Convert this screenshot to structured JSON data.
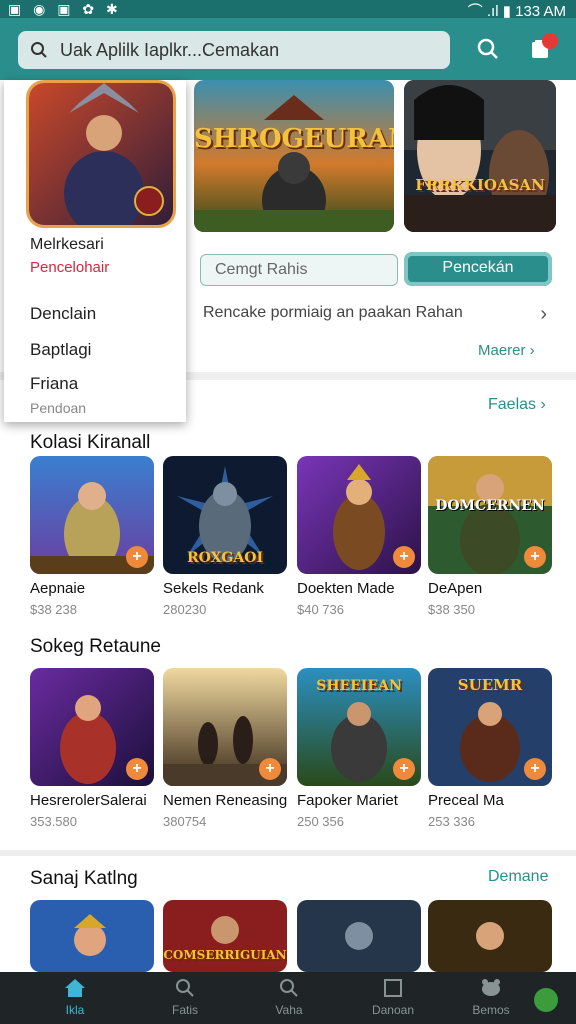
{
  "status_bar": {
    "left_icons": "▣ ◉ ▣ ✿ ✱",
    "right": "⌒ .ıl ▮ 133 AM"
  },
  "header": {
    "search_placeholder": "Uak Aplilk Iaplkr...Cemakan",
    "icons": [
      "search-icon",
      "cart-icon"
    ]
  },
  "featured": {
    "banner1_title": "SHROGEURAN",
    "banner2_title": "FRRKKIOASAN",
    "search_placeholder": "Cemgt Rahis",
    "button_label": "Pencekán",
    "link_text": "Rencake pormiaig an paakan Rahan",
    "more_label": "Maerer"
  },
  "dropdown": {
    "title": "Melrkesari",
    "subtitle": "Pencelohair",
    "items": [
      "Denclain",
      "Baptlagi",
      "Friana"
    ],
    "footer": "Pendoan"
  },
  "sections": [
    {
      "title": "Kolasi Kiranall",
      "link": "Faelas",
      "items": [
        {
          "name": "Aepnaie",
          "price": "$38 238"
        },
        {
          "name": "Sekels Redank",
          "price": "280230"
        },
        {
          "name": "Doekten Made",
          "price": "$40 736"
        },
        {
          "name": "DeApen",
          "price": "$38 350"
        }
      ],
      "overlay_texts": [
        "",
        "ROXGAOI",
        "",
        "DOMCERNEN"
      ]
    },
    {
      "title": "Sokeg Retaune",
      "link": "",
      "items": [
        {
          "name": "HesrerolerSalerai",
          "price": "353.580"
        },
        {
          "name": "Nemen Reneasing",
          "price": "380754"
        },
        {
          "name": "Fapoker Mariet",
          "price": "250 356"
        },
        {
          "name": "Preceal Ma",
          "price": "253 336"
        }
      ],
      "overlay_texts": [
        "",
        "",
        "SHEEIEAN",
        "SUEMR"
      ]
    },
    {
      "title": "Sanaj Katlng",
      "link": "Demane",
      "items": [],
      "overlay_texts": [
        "",
        "COMSERRIGUIAN",
        "",
        ""
      ]
    }
  ],
  "bottom_nav": [
    {
      "label": "Ikla",
      "icon": "home-icon",
      "active": true
    },
    {
      "label": "Fatis",
      "icon": "search-icon",
      "active": false
    },
    {
      "label": "Vaha",
      "icon": "search-icon",
      "active": false
    },
    {
      "label": "Danoan",
      "icon": "square-icon",
      "active": false
    },
    {
      "label": "Bemos",
      "icon": "game-icon",
      "active": false
    }
  ],
  "colors": {
    "teal": "#2a8f8c",
    "status_bar": "#1b6f6d",
    "accent_orange": "#f08a3b",
    "nav_bg": "#1f2526",
    "nav_active": "#3fb6d6"
  }
}
